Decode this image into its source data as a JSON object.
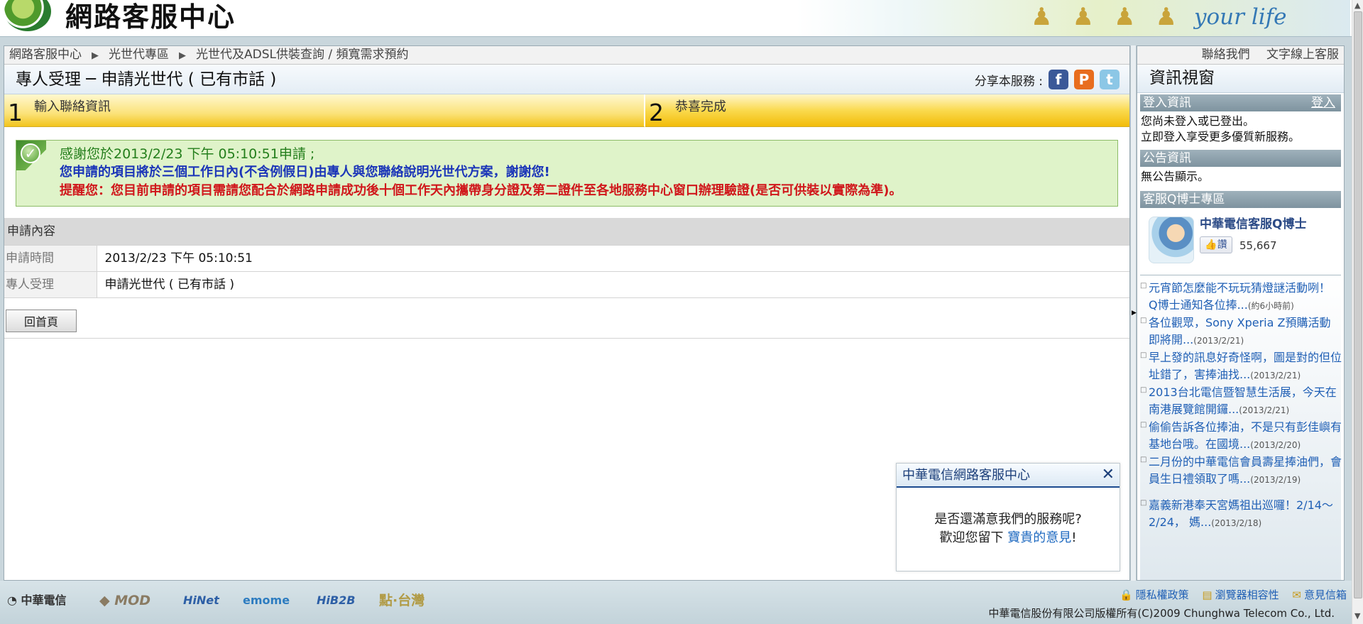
{
  "header": {
    "site_title": "網路客服中心",
    "slogan": "your life"
  },
  "breadcrumb": [
    "網路客服中心",
    "光世代專區",
    "光世代及ADSL供裝查詢 / 頻寬需求預約"
  ],
  "breadcrumb_sep": "▶",
  "page_title": "專人受理 ─ 申請光世代 ( 已有市話 )",
  "share": {
    "label": "分享本服務 :",
    "facebook": "f",
    "plurk": "P",
    "twitter": "t"
  },
  "steps": [
    {
      "num": "1",
      "label": "輸入聯絡資訊"
    },
    {
      "num": "2",
      "label": "恭喜完成"
    }
  ],
  "message": {
    "line1": "感謝您於2013/2/23 下午 05:10:51申請 ;",
    "line2": "您申請的項目將於三個工作日內(不含例假日)由專人與您聯絡說明光世代方案，謝謝您!",
    "line3": "提醒您：您目前申請的項目需請您配合於網路申請成功後十個工作天內攜帶身分證及第二證件至各地服務中心窗口辦理驗證(是否可供裝以實際為準)。",
    "colors": {
      "line1": "#237e1b",
      "line2": "#1b35b8",
      "line3": "#d0171b"
    }
  },
  "details": {
    "header": "申請內容",
    "rows": [
      {
        "key": "申請時間",
        "value": "2013/2/23 下午 05:10:51"
      },
      {
        "key": "專人受理",
        "value": "申請光世代 ( 已有市話 )"
      }
    ]
  },
  "home_button": "回首頁",
  "right_panel": {
    "contact_link": "聯絡我們",
    "text_service_link": "文字線上客服",
    "title": "資訊視窗",
    "login": {
      "head": "登入資訊",
      "link": "登入",
      "text1": "您尚未登入或已登出。",
      "text2": "立即登入享受更多優質新服務。"
    },
    "notice": {
      "head": "公告資訊",
      "text": "無公告顯示。"
    },
    "qdoctor": {
      "head": "客服Q博士專區",
      "page_name": "中華電信客服Q博士",
      "like_label": "讚",
      "like_count": "55,667"
    },
    "news": [
      {
        "text": "元宵節怎麼能不玩玩猜燈謎活動咧！ Q博士通知各位捧...",
        "date": "(約6小時前)"
      },
      {
        "text": "各位觀眾，Sony Xperia Z預購活動即將開...",
        "date": "(2013/2/21)"
      },
      {
        "text": "早上發的訊息好奇怪啊，圖是對的但位址錯了，害捧油找...",
        "date": "(2013/2/21)"
      },
      {
        "text": "2013台北電信暨智慧生活展，今天在南港展覽館開鑼...",
        "date": "(2013/2/21)"
      },
      {
        "text": "偷偷告訴各位捧油，不是只有彭佳嶼有基地台哦。在國境...",
        "date": "(2013/2/20)"
      },
      {
        "text": "二月份的中華電信會員壽星捧油們，會員生日禮領取了嗎...",
        "date": "(2013/2/19)"
      },
      {
        "text": "嘉義新港奉天宮媽祖出巡囉！2/14～2/24， 媽...",
        "date": "(2013/2/18)"
      }
    ]
  },
  "survey": {
    "title": "中華電信網路客服中心",
    "close": "✕",
    "question": "是否還滿意我們的服務呢?",
    "invite_prefix": "歡迎您留下 ",
    "invite_link": "寶貴的意見",
    "invite_suffix": "!"
  },
  "footer": {
    "brands": [
      "中華電信",
      "MOD",
      "HiNet",
      "emome",
      "HiB2B",
      "點·台灣"
    ],
    "links": [
      "隱私權政策",
      "瀏覽器相容性",
      "意見信箱"
    ],
    "copyright": "中華電信股份有限公司版權所有(C)2009 Chunghwa Telecom Co., Ltd."
  }
}
